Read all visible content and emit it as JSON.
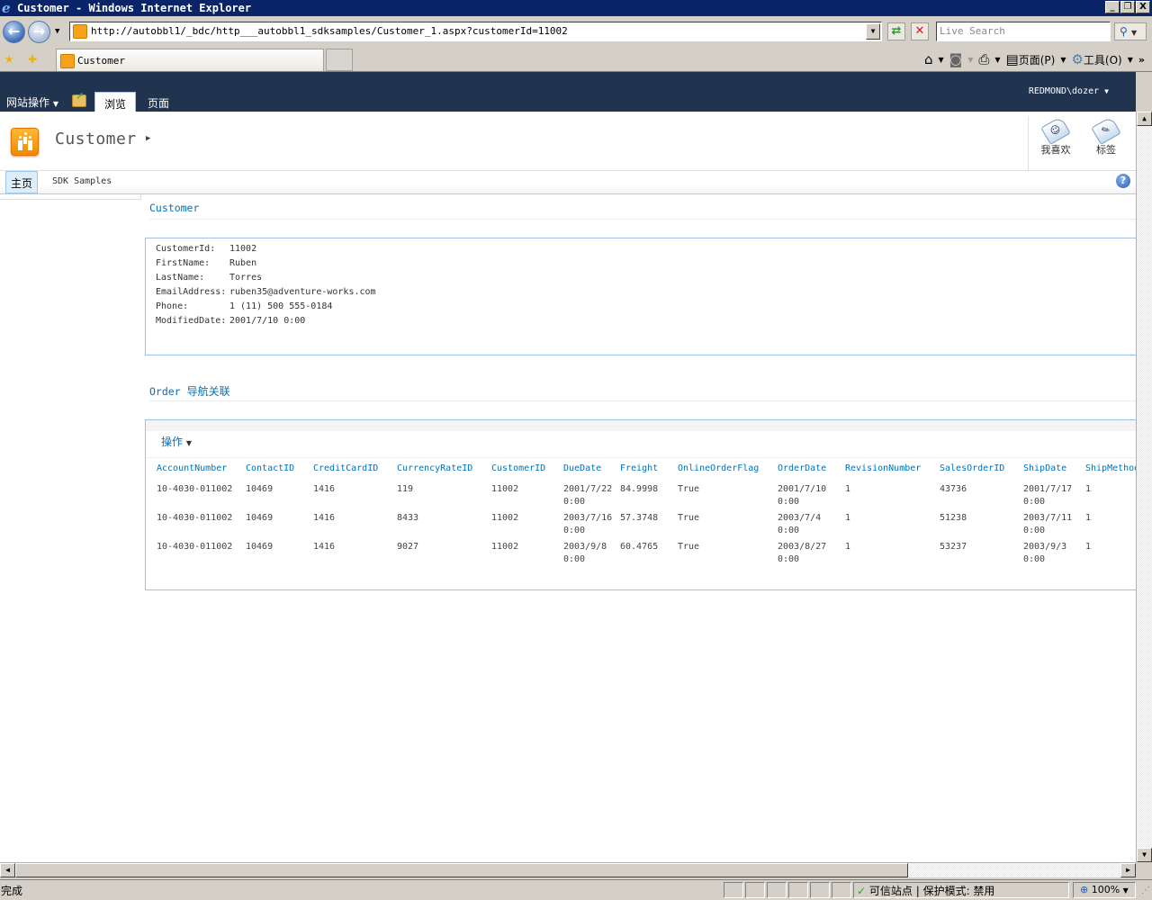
{
  "window": {
    "title": "Customer - Windows Internet Explorer",
    "minimize": "_",
    "restore": "❐",
    "close": "X"
  },
  "browser": {
    "address": "http://autobbl1/_bdc/http___autobbl1_sdksamples/Customer_1.aspx?customerId=11002",
    "search_placeholder": "Live Search",
    "tab_label": "Customer",
    "command_bar": {
      "page_label": "页面(P)",
      "tools_label": "工具(O)"
    }
  },
  "ribbon": {
    "site_actions": "网站操作",
    "tabs": [
      {
        "label": "浏览",
        "active": true
      },
      {
        "label": "页面",
        "active": false
      }
    ],
    "user": "REDMOND\\dozer"
  },
  "title_area": {
    "title": "Customer",
    "social": [
      {
        "label": "我喜欢",
        "icon": "i-like-it-icon"
      },
      {
        "label": "标签",
        "icon": "tags-notes-icon"
      }
    ]
  },
  "top_nav": {
    "items": [
      {
        "label": "主页",
        "active": true
      },
      {
        "label": "SDK Samples",
        "active": false
      }
    ]
  },
  "customer_section": {
    "title": "Customer",
    "fields": [
      {
        "key": "CustomerId:",
        "value": "11002"
      },
      {
        "key": "FirstName:",
        "value": "Ruben"
      },
      {
        "key": "LastName:",
        "value": "Torres"
      },
      {
        "key": "EmailAddress:",
        "value": "ruben35@adventure-works.com"
      },
      {
        "key": "Phone:",
        "value": "1 (11) 500 555-0184"
      },
      {
        "key": "ModifiedDate:",
        "value": "2001/7/10 0:00"
      }
    ]
  },
  "order_section": {
    "title_en": "Order",
    "title_cn": "导航关联",
    "actions_label": "操作",
    "columns": [
      "AccountNumber",
      "ContactID",
      "CreditCardID",
      "CurrencyRateID",
      "CustomerID",
      "DueDate",
      "Freight",
      "OnlineOrderFlag",
      "OrderDate",
      "RevisionNumber",
      "SalesOrderID",
      "ShipDate",
      "ShipMethod"
    ],
    "rows": [
      [
        "10-4030-011002",
        "10469",
        "1416",
        "119",
        "11002",
        "2001/7/22\n0:00",
        "84.9998",
        "True",
        "2001/7/10\n0:00",
        "1",
        "43736",
        "2001/7/17\n0:00",
        "1"
      ],
      [
        "10-4030-011002",
        "10469",
        "1416",
        "8433",
        "11002",
        "2003/7/16\n0:00",
        "57.3748",
        "True",
        "2003/7/4\n0:00",
        "1",
        "51238",
        "2003/7/11\n0:00",
        "1"
      ],
      [
        "10-4030-011002",
        "10469",
        "1416",
        "9027",
        "11002",
        "2003/9/8\n0:00",
        "60.4765",
        "True",
        "2003/8/27\n0:00",
        "1",
        "53237",
        "2003/9/3\n0:00",
        "1"
      ]
    ]
  },
  "status": {
    "text": "完成",
    "zone": "可信站点 | 保护模式: 禁用",
    "zoom": "100%"
  }
}
